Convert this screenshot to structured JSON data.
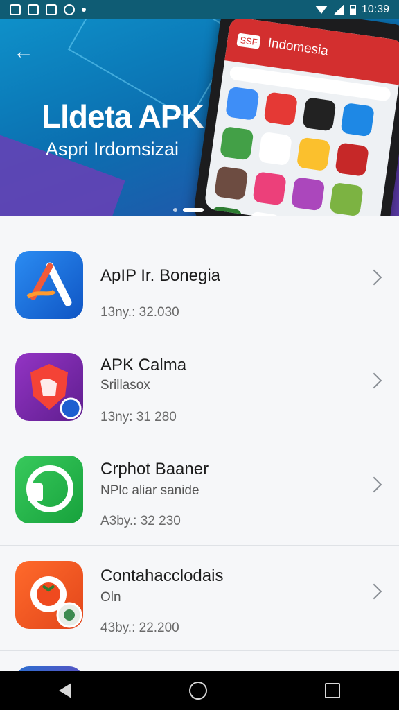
{
  "status_bar": {
    "time": "10:39"
  },
  "hero": {
    "back_icon": "back-arrow-icon",
    "title": "Lldeta APK",
    "subtitle": "Aspri Irdomsizai",
    "phone_screen_header": "Indomesia",
    "phone_logo": "SSF",
    "carousel_pages": 2,
    "carousel_active": 2
  },
  "apps": [
    {
      "name": "ApIP Ir. Bonegia",
      "subtitle": "",
      "meta": "13ny.: 32.030",
      "icon": "app-store-icon",
      "color": "#1a73d9"
    },
    {
      "name": "APK Calma",
      "subtitle": "Srillasox",
      "meta": "13ny: 31 280",
      "icon": "shield-hand-icon",
      "color": "#7b2fa8"
    },
    {
      "name": "Crphot Baaner",
      "subtitle": "NPlc aliar sanide",
      "meta": "A3by.: 32 230",
      "icon": "chat-bubble-icon",
      "color": "#24b34b"
    },
    {
      "name": "Contahacclodais",
      "subtitle": "Oln",
      "meta": "43by.: 22.200",
      "icon": "tomato-timer-icon",
      "color": "#ef5a24"
    }
  ],
  "nav": {
    "back": "back-triangle-icon",
    "home": "home-circle-icon",
    "recents": "recents-square-icon"
  }
}
